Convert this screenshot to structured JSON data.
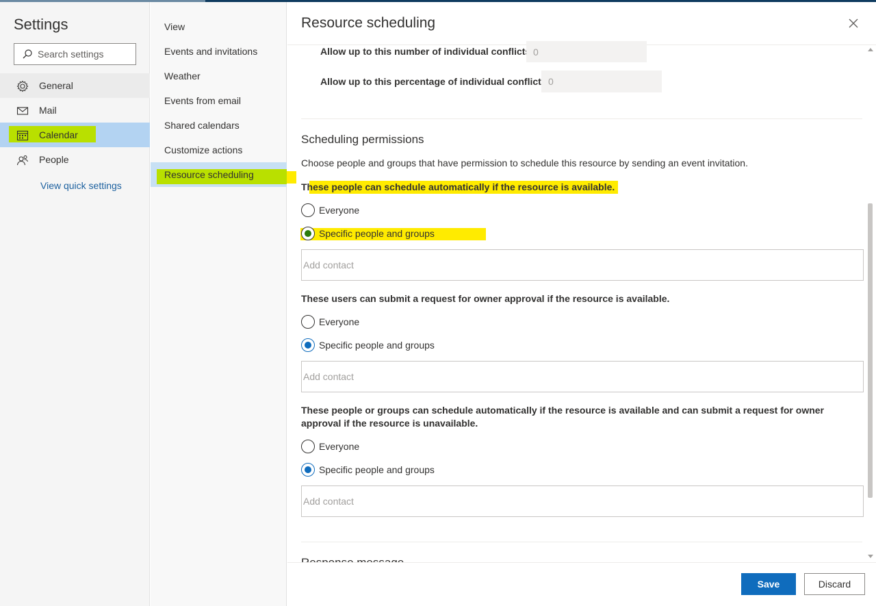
{
  "left_pane": {
    "title": "Settings",
    "search_placeholder": "Search settings",
    "items": [
      {
        "label": "General",
        "icon": "gear-icon"
      },
      {
        "label": "Mail",
        "icon": "mail-icon"
      },
      {
        "label": "Calendar",
        "icon": "calendar-icon"
      },
      {
        "label": "People",
        "icon": "people-icon"
      }
    ],
    "quick_settings": "View quick settings"
  },
  "sub_nav": {
    "items": [
      {
        "label": "View"
      },
      {
        "label": "Events and invitations"
      },
      {
        "label": "Weather"
      },
      {
        "label": "Events from email"
      },
      {
        "label": "Shared calendars"
      },
      {
        "label": "Customize actions"
      },
      {
        "label": "Resource scheduling"
      }
    ]
  },
  "main": {
    "title": "Resource scheduling",
    "conflicts": {
      "number_label": "Allow up to this number of individual conflicts",
      "number_value": "0",
      "percent_label": "Allow up to this percentage of individual conflicts",
      "percent_value": "0"
    },
    "permissions": {
      "title": "Scheduling permissions",
      "description": "Choose people and groups that have permission to schedule this resource by sending an event invitation.",
      "groups": [
        {
          "label": "These people can schedule automatically if the resource is available.",
          "option_everyone": "Everyone",
          "option_specific": "Specific people and groups",
          "selected": "Specific people and groups",
          "contact_placeholder": "Add contact"
        },
        {
          "label": "These users can submit a request for owner approval if the resource is available.",
          "option_everyone": "Everyone",
          "option_specific": "Specific people and groups",
          "selected": "Specific people and groups",
          "contact_placeholder": "Add contact"
        },
        {
          "label": "These people or groups can schedule automatically if the resource is available and can submit a request for owner approval if the resource is unavailable.",
          "option_everyone": "Everyone",
          "option_specific": "Specific people and groups",
          "selected": "Specific people and groups",
          "contact_placeholder": "Add contact"
        }
      ]
    },
    "next_section_title": "Response message"
  },
  "footer": {
    "save_label": "Save",
    "discard_label": "Discard"
  },
  "colors": {
    "accent": "#0f6cbd",
    "highlight_yellow": "#ffeb00",
    "highlight_green": "#b9e000",
    "selected_nav": "#b3d3f2"
  }
}
